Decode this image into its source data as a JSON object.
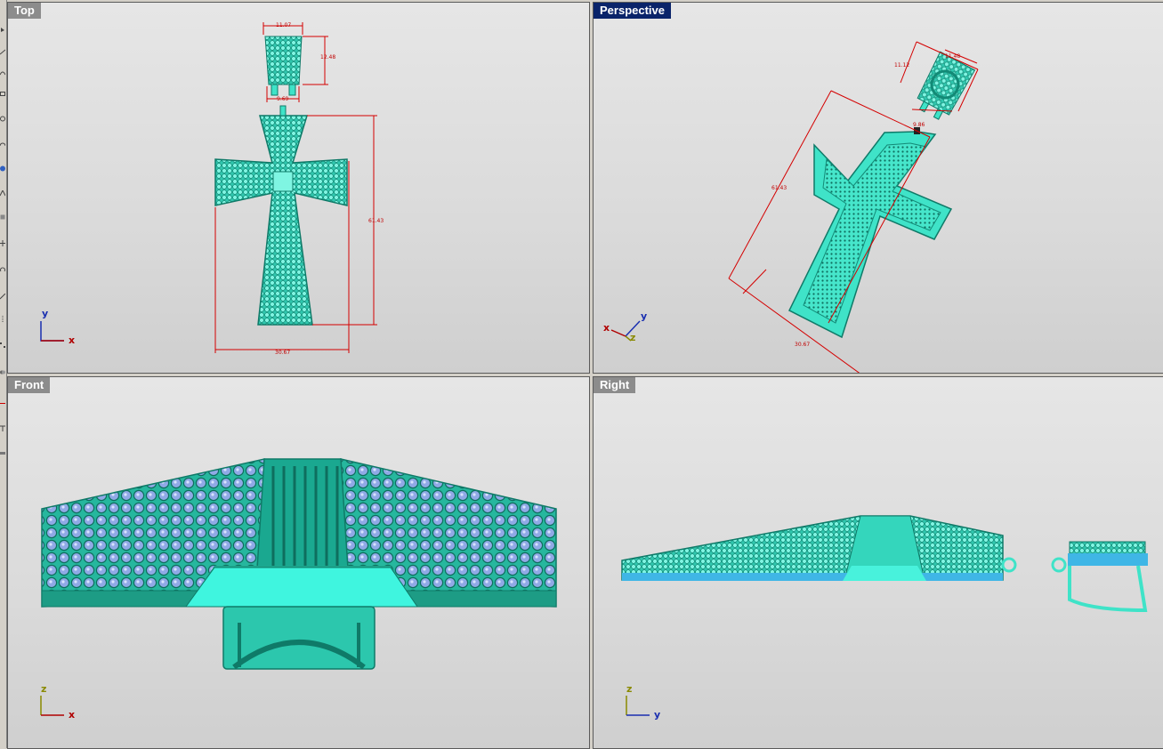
{
  "viewports": {
    "top": {
      "label": "Top",
      "axes": [
        "y",
        "x"
      ],
      "dims": [
        "11.07",
        "12.48",
        "9.69",
        "61.43",
        "30.67"
      ]
    },
    "perspective": {
      "label": "Perspective",
      "axes": [
        "y",
        "x",
        "z"
      ],
      "dims": [
        "11.12",
        "11.48",
        "9.86",
        "61.43",
        "30.67"
      ]
    },
    "front": {
      "label": "Front",
      "axes": [
        "z",
        "x"
      ]
    },
    "right": {
      "label": "Right",
      "axes": [
        "z",
        "y"
      ]
    }
  },
  "colors": {
    "model": "#3fe3c8",
    "model_dark": "#128a76",
    "gem": "#8ea7e6",
    "dimension": "#d40000",
    "axis_x": "#b00000",
    "axis_y": "#1a2fb0",
    "axis_z": "#8a8a00",
    "active_label": "#0a246a"
  },
  "icons": [
    "toolbar-icons"
  ]
}
